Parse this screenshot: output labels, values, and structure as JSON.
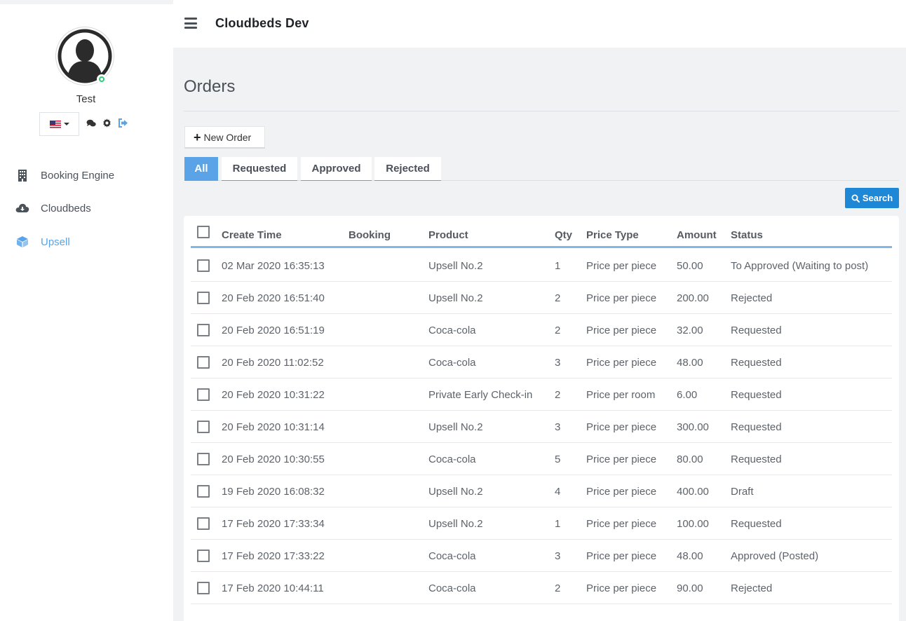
{
  "sidebar": {
    "user_name": "Test",
    "nav": [
      {
        "label": "Booking Engine",
        "icon": "building-icon"
      },
      {
        "label": "Cloudbeds",
        "icon": "cloud-download-icon"
      },
      {
        "label": "Upsell",
        "icon": "cube-icon"
      }
    ]
  },
  "header": {
    "title": "Cloudbeds Dev"
  },
  "main": {
    "title": "Orders",
    "new_order_label": "New Order",
    "tabs": [
      "All",
      "Requested",
      "Approved",
      "Rejected"
    ],
    "search_label": "Search",
    "columns": [
      "Create Time",
      "Booking",
      "Product",
      "Qty",
      "Price Type",
      "Amount",
      "Status"
    ],
    "rows": [
      {
        "time": "02 Mar 2020 16:35:13",
        "product": "Upsell No.2",
        "qty": "1",
        "price_type": "Price per piece",
        "amount": "50.00",
        "status": "To Approved (Waiting to post)"
      },
      {
        "time": "20 Feb 2020 16:51:40",
        "product": "Upsell No.2",
        "qty": "2",
        "price_type": "Price per piece",
        "amount": "200.00",
        "status": "Rejected"
      },
      {
        "time": "20 Feb 2020 16:51:19",
        "product": "Coca-cola",
        "qty": "2",
        "price_type": "Price per piece",
        "amount": "32.00",
        "status": "Requested"
      },
      {
        "time": "20 Feb 2020 11:02:52",
        "product": "Coca-cola",
        "qty": "3",
        "price_type": "Price per piece",
        "amount": "48.00",
        "status": "Requested"
      },
      {
        "time": "20 Feb 2020 10:31:22",
        "product": "Private Early Check-in",
        "qty": "2",
        "price_type": "Price per room",
        "amount": "6.00",
        "status": "Requested"
      },
      {
        "time": "20 Feb 2020 10:31:14",
        "product": "Upsell No.2",
        "qty": "3",
        "price_type": "Price per piece",
        "amount": "300.00",
        "status": "Requested"
      },
      {
        "time": "20 Feb 2020 10:30:55",
        "product": "Coca-cola",
        "qty": "5",
        "price_type": "Price per piece",
        "amount": "80.00",
        "status": "Requested"
      },
      {
        "time": "19 Feb 2020 16:08:32",
        "product": "Upsell No.2",
        "qty": "4",
        "price_type": "Price per piece",
        "amount": "400.00",
        "status": "Draft"
      },
      {
        "time": "17 Feb 2020 17:33:34",
        "product": "Upsell No.2",
        "qty": "1",
        "price_type": "Price per piece",
        "amount": "100.00",
        "status": "Requested"
      },
      {
        "time": "17 Feb 2020 17:33:22",
        "product": "Coca-cola",
        "qty": "3",
        "price_type": "Price per piece",
        "amount": "48.00",
        "status": "Approved (Posted)"
      },
      {
        "time": "17 Feb 2020 10:44:11",
        "product": "Coca-cola",
        "qty": "2",
        "price_type": "Price per piece",
        "amount": "90.00",
        "status": "Rejected"
      }
    ]
  },
  "colors": {
    "accent": "#5aa3e6",
    "search_button": "#1e88d6",
    "online_status": "#2ecc71"
  }
}
